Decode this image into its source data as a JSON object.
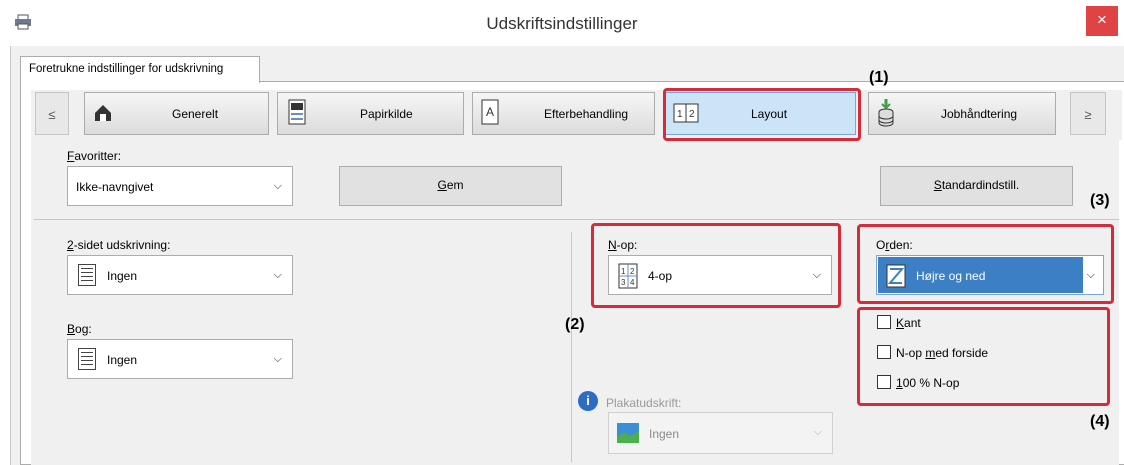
{
  "window": {
    "title": "Udskriftsindstillinger",
    "close_label": "×"
  },
  "tab": {
    "label": "Foretrukne indstillinger for udskrivning"
  },
  "nav": {
    "prev_label": "≤",
    "next_label": "≥",
    "items": [
      {
        "label": "Generelt",
        "icon": "home-icon"
      },
      {
        "label": "Papirkilde",
        "icon": "paper-source-icon"
      },
      {
        "label": "Efterbehandling",
        "icon": "finishing-icon"
      },
      {
        "label": "Layout",
        "icon": "layout-icon",
        "active": true
      },
      {
        "label": "Jobhåndtering",
        "icon": "job-handling-icon"
      }
    ]
  },
  "favorites": {
    "label_first": "F",
    "label_rest": "avoritter:",
    "value": "Ikke-navngivet",
    "save_first": "G",
    "save_rest": "em",
    "defaults_first": "S",
    "defaults_rest": "tandardindstill."
  },
  "duplex": {
    "label_first": "2",
    "label_rest": "-sidet udskrivning:",
    "value": "Ingen"
  },
  "book": {
    "label_first": "B",
    "label_rest": "og:",
    "value": "Ingen"
  },
  "nup": {
    "label_first": "N",
    "label_rest": "-op:",
    "value": "4-op",
    "icon_text": "12 34"
  },
  "order": {
    "label_pre": "O",
    "label_u": "r",
    "label_rest": "den:",
    "value": "Højre og ned"
  },
  "checkboxes": [
    {
      "label_u": "K",
      "label_rest": "ant",
      "checked": false
    },
    {
      "label_pre": "N-op ",
      "label_u": "m",
      "label_rest": "ed forside",
      "checked": false
    },
    {
      "label_u": "1",
      "label_rest": "00 % N-op",
      "checked": false
    }
  ],
  "poster": {
    "label": "Plakatudskrift:",
    "value": "Ingen",
    "info_icon": "i"
  },
  "callouts": {
    "c1": "(1)",
    "c2": "(2)",
    "c3": "(3)",
    "c4": "(4)"
  },
  "colors": {
    "accent": "#3c7fc4",
    "highlight": "#d52b3a",
    "close": "#e04343"
  }
}
